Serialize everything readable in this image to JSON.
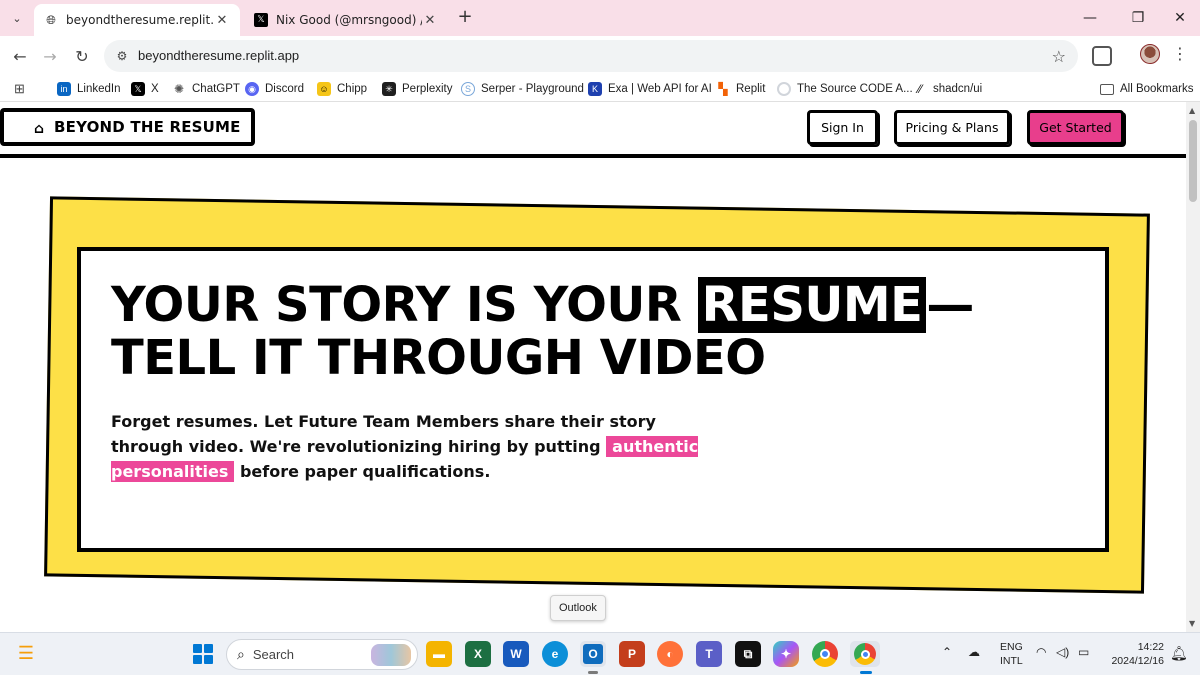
{
  "browser": {
    "tabs": [
      {
        "title": "beyondtheresume.replit.app",
        "active": true,
        "favicon": "globe-icon"
      },
      {
        "title": "Nix Good (@mrsngood) / X",
        "active": false,
        "favicon": "x-logo-icon"
      }
    ],
    "url": "beyondtheresume.replit.app",
    "bookmarks": [
      {
        "label": "LinkedIn",
        "icon": "linkedin-icon",
        "color": "#0a66c2"
      },
      {
        "label": "X",
        "icon": "x-logo-icon",
        "color": "#000000"
      },
      {
        "label": "ChatGPT",
        "icon": "chatgpt-icon",
        "color": "#5a5a5a"
      },
      {
        "label": "Discord",
        "icon": "discord-icon",
        "color": "#5865f2"
      },
      {
        "label": "Chipp",
        "icon": "chipp-icon",
        "color": "#f5c518"
      },
      {
        "label": "Perplexity",
        "icon": "perplexity-icon",
        "color": "#1f1f1f"
      },
      {
        "label": "Serper - Playground",
        "icon": "serper-icon",
        "color": "#7aa7d9"
      },
      {
        "label": "Exa | Web API for AI",
        "icon": "exa-icon",
        "color": "#1e40af"
      },
      {
        "label": "Replit",
        "icon": "replit-icon",
        "color": "#f26207"
      },
      {
        "label": "The Source CODE A...",
        "icon": "loading-icon",
        "color": "#9ca3af"
      },
      {
        "label": "shadcn/ui",
        "icon": "shadcn-icon",
        "color": "#111111"
      }
    ],
    "all_bookmarks": "All Bookmarks"
  },
  "site": {
    "brand": "BEYOND THE RESUME",
    "nav": {
      "sign_in": "Sign In",
      "pricing": "Pricing & Plans",
      "get_started": "Get Started"
    },
    "hero": {
      "title_before": "YOUR STORY IS YOUR ",
      "title_highlight": "RESUME",
      "title_after": "—TELL IT THROUGH VIDEO",
      "subtitle_before": "Forget resumes. Let Future Team Members share their story through video. We're revolutionizing hiring by putting ",
      "subtitle_highlight": "authentic personalities",
      "subtitle_after": " before paper qualifications."
    },
    "colors": {
      "accent_pink": "#e83e8c",
      "highlight_pink": "#ec4899",
      "card_yellow": "#fde047",
      "ink": "#000000"
    }
  },
  "tooltip": "Outlook",
  "taskbar": {
    "search_placeholder": "Search",
    "apps": [
      "file-explorer-icon",
      "excel-icon",
      "word-icon",
      "edge-icon",
      "outlook-icon",
      "powerpoint-icon",
      "firefox-icon",
      "teams-icon",
      "capcut-icon",
      "copilot-icon",
      "chrome-icon",
      "chrome-active-icon"
    ],
    "language_line1": "ENG",
    "language_line2": "INTL",
    "time": "14:22",
    "date": "2024/12/16"
  }
}
